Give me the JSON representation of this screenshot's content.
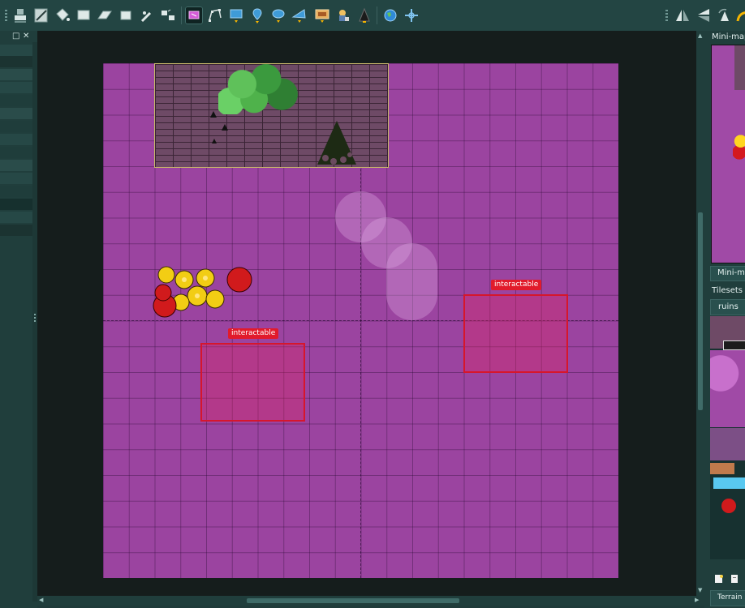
{
  "toolbar": {
    "tools": [
      {
        "name": "stamp-brush-icon",
        "active": false
      },
      {
        "name": "terrain-brush-icon",
        "active": false
      },
      {
        "name": "bucket-fill-icon",
        "active": false
      },
      {
        "name": "shape-fill-icon",
        "active": false
      },
      {
        "name": "eraser-icon",
        "active": false
      },
      {
        "name": "rect-select-icon",
        "active": false
      },
      {
        "name": "magic-wand-icon",
        "active": false
      },
      {
        "name": "select-same-tile-icon",
        "active": false
      },
      {
        "name": "select-objects-icon",
        "active": true
      },
      {
        "name": "edit-polygons-icon",
        "active": false
      },
      {
        "name": "insert-rectangle-icon",
        "active": false
      },
      {
        "name": "insert-point-icon",
        "active": false
      },
      {
        "name": "insert-ellipse-icon",
        "active": false
      },
      {
        "name": "insert-polygon-icon",
        "active": false
      },
      {
        "name": "insert-tile-icon",
        "active": false
      },
      {
        "name": "insert-template-icon",
        "active": false
      },
      {
        "name": "insert-text-icon",
        "active": false
      },
      {
        "name": "world-icon",
        "active": false
      },
      {
        "name": "move-icon",
        "active": false
      }
    ],
    "right_tools": [
      "flip-horizontal-icon",
      "flip-vertical-icon",
      "rotate-left-icon",
      "rotate-right-icon"
    ]
  },
  "map": {
    "objects": [
      {
        "label": "interactable"
      },
      {
        "label": "interactable"
      }
    ]
  },
  "right_dock": {
    "minimap_title": "Mini-map",
    "minimap_tab": "Mini-map",
    "tilesets_title": "Tilesets",
    "tileset_tab": "ruins",
    "terrain_tab": "Terrain Sets"
  },
  "colors": {
    "map_background": "#9b44a0",
    "zone_border": "#d6162c",
    "label_background": "#e11b2b"
  }
}
